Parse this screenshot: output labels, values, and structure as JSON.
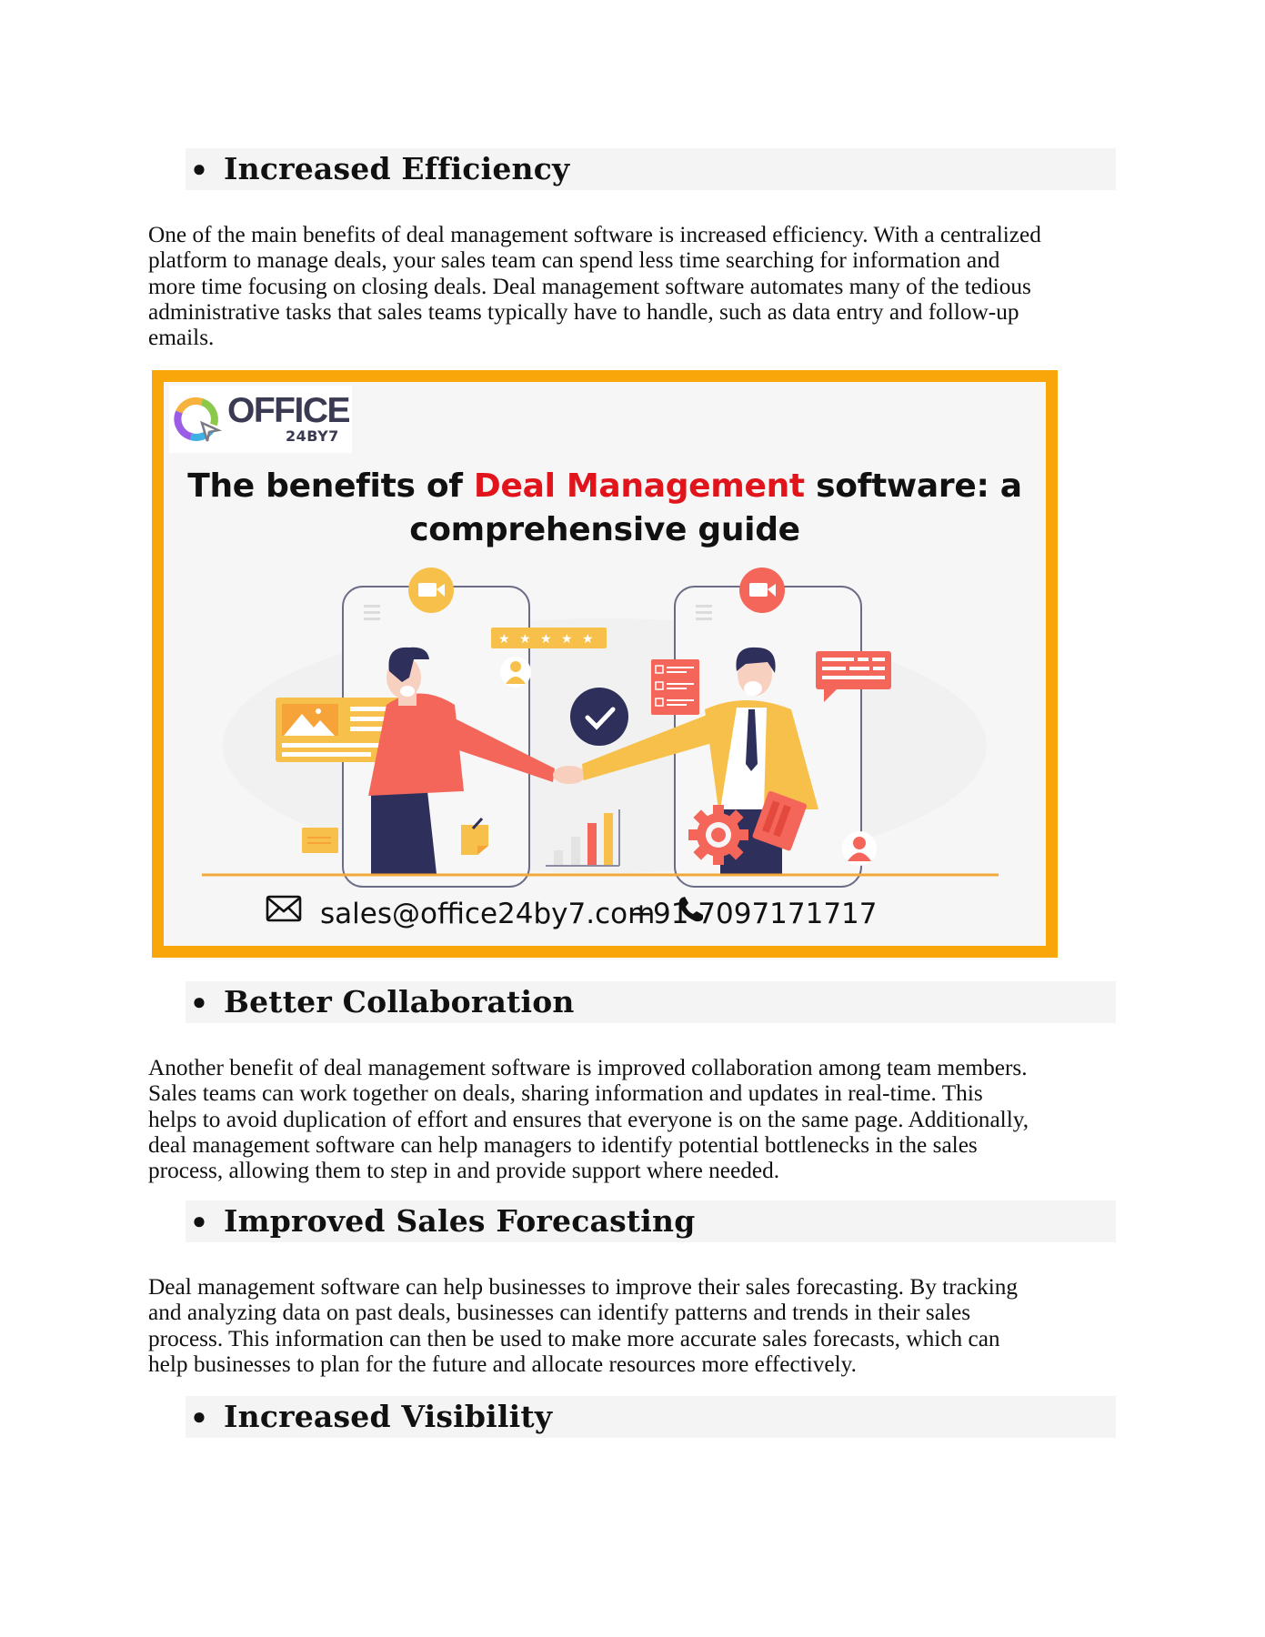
{
  "sections": [
    {
      "heading": "Increased Efficiency",
      "bullet": "●",
      "lines": [
        "One of the main benefits of deal management software is increased efficiency. With a centralized",
        "platform to manage deals, your sales team can spend less time searching for information and",
        "more time focusing on closing deals. Deal management software automates many of the tedious",
        "administrative tasks that sales teams typically have to handle, such as data entry and follow-up",
        "emails."
      ]
    },
    {
      "heading": "Better Collaboration",
      "bullet": "●",
      "lines": [
        "Another benefit of deal management software is improved collaboration among team members.",
        "Sales teams can work together on deals, sharing information and updates in real-time. This",
        "helps to avoid duplication of effort and ensures that everyone is on the same page. Additionally,",
        "deal management software can help managers to identify potential bottlenecks in the sales",
        "process, allowing them to step in and provide support where needed."
      ]
    },
    {
      "heading": "Improved Sales Forecasting",
      "bullet": "●",
      "lines": [
        "Deal management software can help businesses to improve their sales forecasting. By tracking",
        "and analyzing data on past deals, businesses can identify patterns and trends in their sales",
        "process. This information can then be used to make more accurate sales forecasts, which can",
        "help businesses to plan for the future and allocate resources more effectively."
      ]
    },
    {
      "heading": "Increased Visibility",
      "bullet": "●",
      "lines": []
    }
  ],
  "banner": {
    "logo": {
      "name": "OFFICE",
      "sub": "24BY7",
      "ring_colors": [
        "#f6b23c",
        "#8cc84b",
        "#3fb0e4",
        "#9b5de5"
      ]
    },
    "title_part1": "The benefits of ",
    "title_accent": "Deal Management",
    "title_part2": " software: a",
    "title_line2": "comprehensive guide",
    "email": "sales@office24by7.com",
    "phone": "+91 7097171717",
    "icons": {
      "email": "envelope-icon",
      "phone": "phone-icon"
    },
    "colors": {
      "frame": "#f9a60a",
      "accent": "#e0141a",
      "red": "#f4665a",
      "yellow": "#f7c04a",
      "navy": "#2f2f5b"
    },
    "rating_stars": 5
  }
}
